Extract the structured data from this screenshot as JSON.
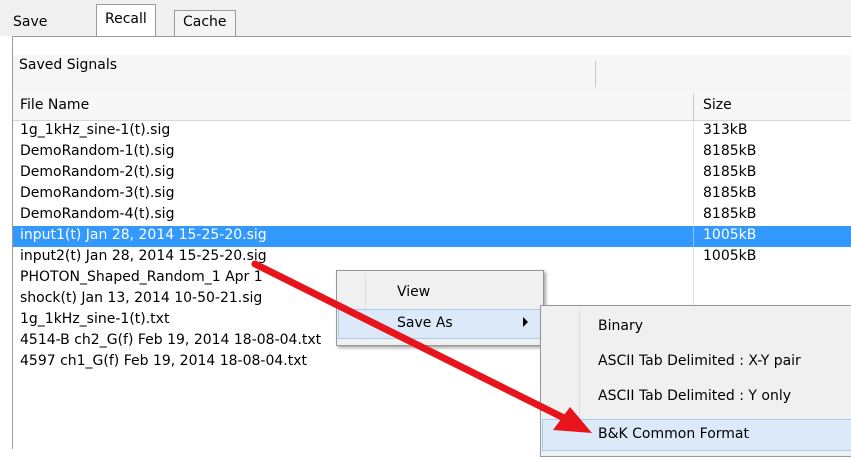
{
  "tabs": [
    {
      "label": "Save"
    },
    {
      "label": "Recall"
    },
    {
      "label": "Cache"
    }
  ],
  "group_title": "Saved Signals",
  "columns": {
    "name": "File Name",
    "size": "Size"
  },
  "files": [
    {
      "name": "1g_1kHz_sine-1(t).sig",
      "size": "313kB"
    },
    {
      "name": "DemoRandom-1(t).sig",
      "size": "8185kB"
    },
    {
      "name": "DemoRandom-2(t).sig",
      "size": "8185kB"
    },
    {
      "name": "DemoRandom-3(t).sig",
      "size": "8185kB"
    },
    {
      "name": "DemoRandom-4(t).sig",
      "size": "8185kB"
    },
    {
      "name": "input1(t) Jan 28, 2014 15-25-20.sig",
      "size": "1005kB"
    },
    {
      "name": "input2(t) Jan 28, 2014 15-25-20.sig",
      "size": "1005kB"
    },
    {
      "name": "PHOTON_Shaped_Random_1 Apr 1",
      "size": ""
    },
    {
      "name": "shock(t) Jan 13, 2014 10-50-21.sig",
      "size": ""
    },
    {
      "name": "1g_1kHz_sine-1(t).txt",
      "size": ""
    },
    {
      "name": "4514-B ch2_G(f) Feb 19, 2014 18-08-04.txt",
      "size": ""
    },
    {
      "name": "4597 ch1_G(f) Feb 19, 2014 18-08-04.txt",
      "size": ""
    }
  ],
  "context_menu": {
    "view": "View",
    "save_as": "Save As"
  },
  "save_as_menu": {
    "binary": "Binary",
    "ascii_xy": "ASCII Tab Delimited : X-Y pair",
    "ascii_y": "ASCII Tab Delimited : Y only",
    "bk": "B&K Common Format"
  },
  "colors": {
    "selection": "#3399ff",
    "arrow": "#e8141b"
  }
}
